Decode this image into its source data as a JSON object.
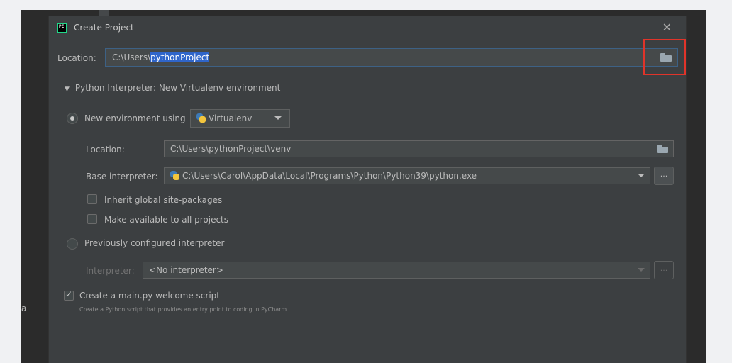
{
  "background": {
    "side_label": "a"
  },
  "dialog": {
    "title": "Create Project",
    "close_glyph": "✕",
    "location": {
      "label": "Location:",
      "value_prefix": "C:\\Users\\",
      "value_selected": "pythonProject"
    },
    "interpreter_section": {
      "header": "Python Interpreter: New Virtualenv environment",
      "new_env": {
        "label": "New environment using",
        "selected": true,
        "tool": "Virtualenv",
        "location_label": "Location:",
        "location_value": "C:\\Users\\pythonProject\\venv",
        "base_label": "Base interpreter:",
        "base_value": "C:\\Users\\Carol\\AppData\\Local\\Programs\\Python\\Python39\\python.exe",
        "more_label": "...",
        "inherit_label": "Inherit global site-packages",
        "inherit_checked": false,
        "available_label": "Make available to all projects",
        "available_checked": false
      },
      "previous": {
        "label": "Previously configured interpreter",
        "selected": false,
        "interpreter_label": "Interpreter:",
        "interpreter_value": "<No interpreter>",
        "more_label": "..."
      }
    },
    "welcome": {
      "label": "Create a main.py welcome script",
      "checked": true,
      "hint": "Create a Python script that provides an entry point to coding in PyCharm."
    }
  },
  "icons": {
    "app": "pycharm-icon",
    "folder": "folder-icon",
    "python": "python-icon"
  },
  "colors": {
    "selection": "#2f65ca",
    "highlight_box": "#e0342a",
    "dialog_bg": "#3c3f41"
  }
}
